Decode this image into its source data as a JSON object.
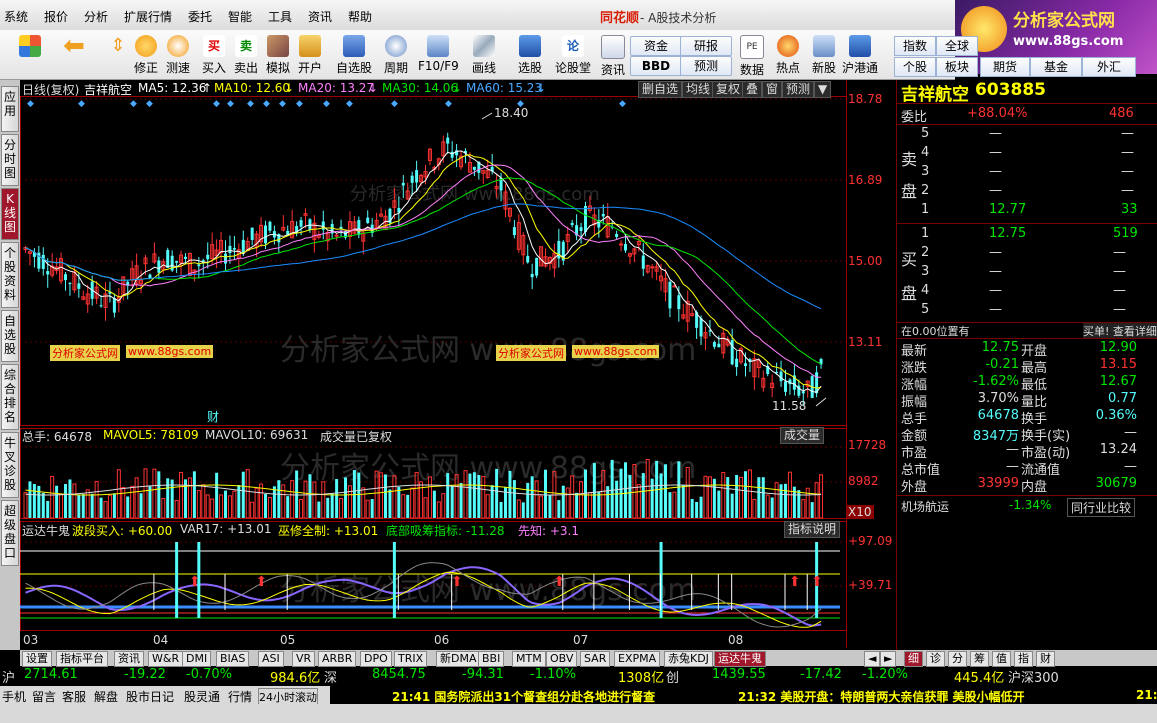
{
  "menu": {
    "items": [
      "系统",
      "报价",
      "分析",
      "扩展行情",
      "委托",
      "智能",
      "工具",
      "资讯",
      "帮助"
    ],
    "brand": "同花顺",
    "brand_sub": "- A股技术分析"
  },
  "logo": {
    "title": "分析家公式网",
    "url": "www.88gs.com"
  },
  "toolbar": {
    "buttons": [
      "修正",
      "测速",
      "买入",
      "卖出",
      "模拟",
      "开户",
      "自选股",
      "周期",
      "F10/F9",
      "画线",
      "选股",
      "论股堂",
      "资讯",
      "数据",
      "热点",
      "新股",
      "沪港通"
    ],
    "small_buttons": [
      "资金",
      "研报",
      "BBD",
      "预测"
    ],
    "right_tabs": [
      "指数",
      "全球",
      "个股",
      "板块",
      "期货",
      "基金",
      "外汇"
    ]
  },
  "left_tabs": [
    "应用",
    "分时图",
    "K线图",
    "个股资料",
    "自选股",
    "综合排名",
    "牛叉诊股",
    "超级盘口"
  ],
  "kline_header": {
    "period": "日线(复权)",
    "name": "吉祥航空",
    "ma5": "MA5: 12.36",
    "ma10": "MA10: 12.60",
    "ma20": "MA20: 13.27",
    "ma30": "MA30: 14.06",
    "ma60": "MA60: 15.23",
    "buttons": [
      "删自选",
      "均线",
      "复权",
      "叠",
      "窗",
      "预测"
    ]
  },
  "price_axis": [
    "18.78",
    "16.89",
    "15.00",
    "13.11"
  ],
  "annotations": {
    "high": "18.40",
    "low": "11.58",
    "cai": "财"
  },
  "watermark": {
    "text": "分析家公式网",
    "url": "www.88gs.com"
  },
  "vol_header": {
    "total": "总手: 64678",
    "mavol5": "MAVOL5: 78109",
    "mavol10": "MAVOL10: 69631",
    "note": "成交量已复权",
    "button": "成交量"
  },
  "vol_axis": [
    "17728",
    "8982",
    "X10"
  ],
  "ind_header": {
    "name": "运达牛鬼",
    "b1": "波段买入: +60.00",
    "b2": "VAR17: +13.01",
    "b3": "巫修全制: +13.01",
    "b4": "底部吸筹指标: -11.28",
    "b5": "先知: +3.1",
    "button": "指标说明"
  },
  "ind_axis": [
    "+97.09",
    "+39.71"
  ],
  "months": [
    "03",
    "04",
    "05",
    "06",
    "07",
    "08"
  ],
  "chart_data": {
    "type": "candlestick",
    "title": "吉祥航空",
    "ylim": [
      10.9,
      19.3
    ],
    "high": 18.4,
    "low": 11.58,
    "ma": {
      "MA5": 12.36,
      "MA10": 12.6,
      "MA20": 13.27,
      "MA30": 14.06,
      "MA60": 15.23
    },
    "volume_axis": [
      8982,
      17728
    ],
    "indicator_axis": [
      39.71,
      97.09
    ]
  },
  "quote": {
    "name": "吉祥航空",
    "code": "603885",
    "weibi_label": "委比",
    "weibi": "+88.04%",
    "weibi_n": "486",
    "sell_label": [
      "卖",
      "盘"
    ],
    "buy_label": [
      "买",
      "盘"
    ],
    "sells": [
      {
        "lvl": "5",
        "price": "—",
        "vol": "—"
      },
      {
        "lvl": "4",
        "price": "—",
        "vol": "—"
      },
      {
        "lvl": "3",
        "price": "—",
        "vol": "—"
      },
      {
        "lvl": "2",
        "price": "—",
        "vol": "—"
      },
      {
        "lvl": "1",
        "price": "12.77",
        "vol": "33"
      }
    ],
    "buys": [
      {
        "lvl": "1",
        "price": "12.75",
        "vol": "519"
      },
      {
        "lvl": "2",
        "price": "—",
        "vol": "—"
      },
      {
        "lvl": "3",
        "price": "—",
        "vol": "—"
      },
      {
        "lvl": "4",
        "price": "—",
        "vol": "—"
      },
      {
        "lvl": "5",
        "price": "—",
        "vol": "—"
      }
    ],
    "position_note": "在0.00位置有",
    "buy_note": "买单! 查看详细",
    "stats": [
      {
        "l1": "最新",
        "v1": "12.75",
        "l2": "开盘",
        "v2": "12.90"
      },
      {
        "l1": "涨跌",
        "v1": "-0.21",
        "l2": "最高",
        "v2": "13.15"
      },
      {
        "l1": "涨幅",
        "v1": "-1.62%",
        "l2": "最低",
        "v2": "12.67"
      },
      {
        "l1": "振幅",
        "v1": "3.70%",
        "l2": "量比",
        "v2": "0.77"
      },
      {
        "l1": "总手",
        "v1": "64678",
        "l2": "换手",
        "v2": "0.36%"
      },
      {
        "l1": "金额",
        "v1": "8347万",
        "l2": "换手(实)",
        "v2": "—"
      },
      {
        "l1": "市盈",
        "v1": "—",
        "l2": "市盈(动)",
        "v2": "13.24"
      },
      {
        "l1": "总市值",
        "v1": "—",
        "l2": "流通值",
        "v2": "—"
      },
      {
        "l1": "外盘",
        "v1": "33999",
        "l2": "内盘",
        "v2": "30679"
      }
    ],
    "sector_name": "机场航运",
    "sector_change": "-1.34%",
    "sector_button": "同行业比较"
  },
  "bottom_tabs": [
    "设置",
    "指标平台",
    "资讯",
    "W&R",
    "DMI",
    "BIAS",
    "ASI",
    "VR",
    "ARBR",
    "DPO",
    "TRIX",
    "新DMA",
    "BBI",
    "MTM",
    "OBV",
    "SAR",
    "EXPMA",
    "赤兔KDJ",
    "运达牛鬼"
  ],
  "right_bottom_tabs": [
    "细",
    "诊",
    "分",
    "筹",
    "值",
    "指",
    "财"
  ],
  "index_row": {
    "sh_label": "沪",
    "sh": "2714.61",
    "sh_chg": "-19.22",
    "sh_pct": "-0.70%",
    "sh_amt": "984.6亿",
    "sz_label": "深",
    "sz": "8454.75",
    "sz_chg": "-94.31",
    "sz_pct": "-1.10%",
    "sz_amt": "1308亿",
    "cy_label": "创",
    "cy": "1439.55",
    "cy_chg": "-17.42",
    "cy_pct": "-1.20%",
    "cy_amt": "445.4亿",
    "hs_label": "沪深300"
  },
  "status": {
    "items": [
      "手机",
      "留言",
      "客服",
      "解盘",
      "股市日记",
      "股灵通",
      "行情",
      "24小时滚动"
    ],
    "news1": "21:41 国务院派出31个督查组分赴各地进行督查",
    "news2": "21:32 美股开盘：特朗普两大亲信获罪 美股小幅低开",
    "news3": "21:"
  },
  "colors": {
    "up": "#ff3232",
    "down": "#54fcfc",
    "ma5": "#ffffff",
    "ma10": "#ffff00",
    "ma20": "#ff80ff",
    "ma30": "#00e600",
    "ma60": "#1a8cff"
  }
}
